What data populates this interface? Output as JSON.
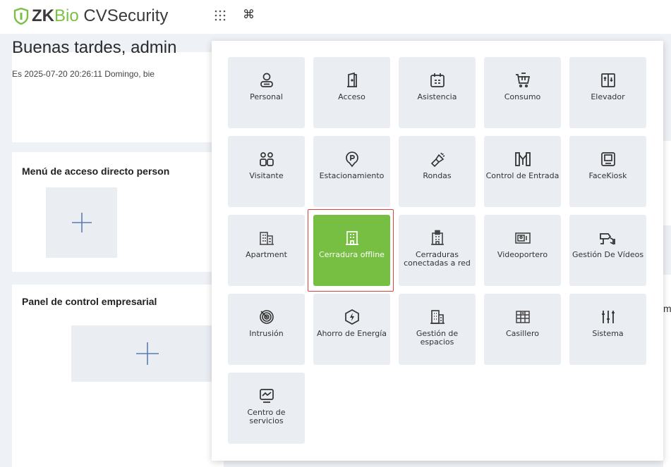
{
  "header": {
    "logo_zk": "ZK",
    "logo_bio": "Bio",
    "logo_rest": " CVSecurity",
    "grid_icon": "apps-grid-icon",
    "cmd_symbol": "⌘"
  },
  "background": {
    "greeting": "Buenas tardes, admin",
    "date_line": "Es 2025-07-20 20:26:11 Domingo, bie",
    "quick_menu_title": "Menú de acceso directo person",
    "panel_title": "Panel de control empresarial",
    "right_peek": "m"
  },
  "menu": {
    "tiles": [
      {
        "label": "Personal",
        "icon": "person-icon"
      },
      {
        "label": "Acceso",
        "icon": "door-icon"
      },
      {
        "label": "Asistencia",
        "icon": "calendar-icon"
      },
      {
        "label": "Consumo",
        "icon": "cart-icon"
      },
      {
        "label": "Elevador",
        "icon": "elevator-icon"
      },
      {
        "label": "Visitante",
        "icon": "visitors-icon"
      },
      {
        "label": "Estacionamiento",
        "icon": "parking-icon"
      },
      {
        "label": "Rondas",
        "icon": "flashlight-icon"
      },
      {
        "label": "Control de Entrada",
        "icon": "turnstile-icon"
      },
      {
        "label": "FaceKiosk",
        "icon": "kiosk-icon"
      },
      {
        "label": "Apartment",
        "icon": "apartment-icon"
      },
      {
        "label": "Cerradura offline",
        "icon": "building-lock-icon",
        "active": true
      },
      {
        "label": "Cerraduras conectadas a red",
        "icon": "building-network-icon"
      },
      {
        "label": "Videoportero",
        "icon": "video-intercom-icon"
      },
      {
        "label": "Gestión De Vídeos",
        "icon": "camera-icon"
      },
      {
        "label": "Intrusión",
        "icon": "radar-icon"
      },
      {
        "label": "Ahorro de Energía",
        "icon": "energy-icon"
      },
      {
        "label": "Gestión de espacios",
        "icon": "office-building-icon"
      },
      {
        "label": "Casillero",
        "icon": "locker-icon"
      },
      {
        "label": "Sistema",
        "icon": "sliders-icon"
      },
      {
        "label": "Centro de servicios",
        "icon": "monitor-chart-icon"
      }
    ]
  },
  "colors": {
    "brand_green": "#76bf42",
    "active_border": "#e0403a",
    "tile_bg": "#eaeef3",
    "page_bg": "#eef1f5"
  }
}
